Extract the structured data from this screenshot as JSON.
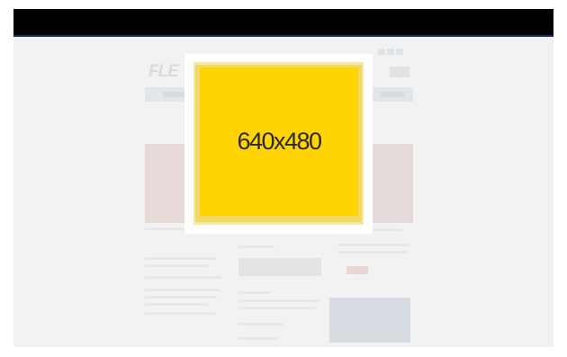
{
  "ad": {
    "placeholder_text": "640x480",
    "background_color": "#ffd400"
  },
  "background_page": {
    "logo_text": "FLE"
  },
  "colors": {
    "browser_bar": "#000000",
    "viewport_background": "#f4f4f4",
    "modal_background": "#ffffff"
  }
}
